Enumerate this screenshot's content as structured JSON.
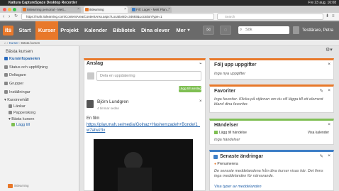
{
  "menubar": {
    "app_name": "Kaltura CaptureSpace Desktop Recorder",
    "clock": "Fre 23 aug. 16:08"
  },
  "browser": {
    "tabs": [
      {
        "label": "itslearning personal - Mett..."
      },
      {
        "label": "itslearning"
      },
      {
        "label": "Fill: Lager - Mett Plan..."
      }
    ],
    "url": "https://mah.itslearning.com/ContentArea/ContentArea.aspx?LocationID=34693&LocationType=1",
    "search_placeholder": "Search"
  },
  "app": {
    "logo": "its",
    "nav": [
      "Start",
      "Kurser",
      "Projekt",
      "Kalender",
      "Bibliotek",
      "Dina elever",
      "Mer"
    ],
    "more_chevron": "▾",
    "search_placeholder": "Sök",
    "user_name": "Testlärare, Petra"
  },
  "breadcrumb": {
    "home": "⌂",
    "items": [
      "Kurser",
      "Bästa kursen"
    ]
  },
  "sidebar": {
    "title": "Bästa kursen",
    "items": [
      {
        "label": "Kursinfopanelen",
        "active": true
      },
      {
        "label": "Status och uppföljning"
      },
      {
        "label": "Deltagare"
      },
      {
        "label": "Grupper"
      },
      {
        "label": "Inställningar"
      },
      {
        "label": "Kursinnehåll"
      },
      {
        "label": "Länkar"
      },
      {
        "label": "Papperskorg"
      },
      {
        "label": "Bästa kursen"
      },
      {
        "label": "Lägg till"
      }
    ],
    "footer": "itslearning"
  },
  "anslag": {
    "title": "Anslag",
    "input_placeholder": "Dela en uppdatering",
    "post_button": "Lägg till anslag",
    "post": {
      "author": "Björn Lundgren",
      "time": "4 timmar sedan",
      "body": "En film",
      "link": "https://play.mah.se/media/Golnaz+Hashemzadeh+Bonde/1_w7atwz3x"
    }
  },
  "panels": {
    "folj": {
      "title": "Följ upp uppgifter",
      "empty": "Inga nya uppgifter"
    },
    "favoriter": {
      "title": "Favoriter",
      "text": "Inga favoriter. Klicka på stjärnan om du vill lägga till ett element bland dina favoriter."
    },
    "handelser": {
      "title": "Händelser",
      "add": "Lägg till händelse",
      "show_calendar": "Visa kalender",
      "empty": "Inga händelser"
    },
    "andringar": {
      "title": "Senaste ändringar",
      "subscribe": "Prenumerera",
      "text": "De senaste meddelandena från dina kurser visas här. Det finns inga meddelanden för närvarande.",
      "more": "Visa typer av meddelanden"
    }
  },
  "colors": {
    "accent": "#e8782a",
    "nav_bg": "#6a6a6a",
    "green": "#7fbf53",
    "blue": "#3e7fc7"
  }
}
